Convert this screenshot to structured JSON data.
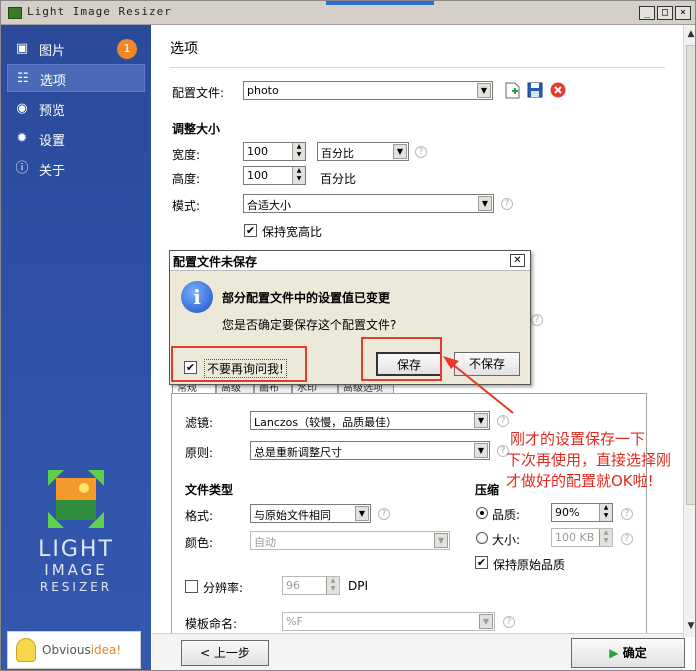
{
  "window": {
    "title": "Light Image Resizer",
    "buttons": [
      "_",
      "□",
      "×"
    ]
  },
  "sidebar": {
    "items": [
      {
        "label": "图片",
        "icon": "images-icon",
        "badge": "1"
      },
      {
        "label": "选项",
        "icon": "sliders-icon"
      },
      {
        "label": "预览",
        "icon": "eye-icon"
      },
      {
        "label": "设置",
        "icon": "gear-icon"
      },
      {
        "label": "关于",
        "icon": "info-icon"
      }
    ],
    "logo_lines": [
      "LIGHT",
      "IMAGE",
      "RESIZER"
    ],
    "brand": {
      "prefix": "Obvious",
      "suffix": "idea!"
    }
  },
  "options": {
    "title": "选项",
    "profile_label": "配置文件:",
    "profile_value": "photo",
    "resize_section": "调整大小",
    "width_label": "宽度:",
    "width_value": "100",
    "width_unit": "百分比",
    "height_label": "高度:",
    "height_value": "100",
    "height_unit": "百分比",
    "mode_label": "模式:",
    "mode_value": "合适大小",
    "keep_ratio_label": "保持宽高比",
    "keep_ratio_checked": "✔"
  },
  "panel": {
    "tabs": [
      "常规",
      "高级",
      "画布",
      "水印",
      "高级选项"
    ],
    "filter_label": "滤镜:",
    "filter_value": "Lanczos（较慢，品质最佳）",
    "rule_label": "原则:",
    "rule_value": "总是重新调整尺寸",
    "filetype_section": "文件类型",
    "format_label": "格式:",
    "format_value": "与原始文件相同",
    "color_label": "颜色:",
    "color_value": "自动",
    "compress_section": "压缩",
    "quality_label": "品质:",
    "quality_value": "90%",
    "size_label": "大小:",
    "size_value": "100 KB",
    "keep_quality_label": "保持原始品质",
    "keep_quality_checked": "✔",
    "resolution_label": "分辨率:",
    "resolution_value": "96",
    "resolution_unit": "DPI",
    "template_label": "模板命名:",
    "template_value": "%F"
  },
  "footer": {
    "prev_label": "< 上一步",
    "ok_label": "确定"
  },
  "dialog": {
    "title": "配置文件未保存",
    "heading": "部分配置文件中的设置值已变更",
    "message": "您是否确定要保存这个配置文件?",
    "dont_ask_label": "不要再询问我!",
    "dont_ask_checked": "✔",
    "save_label": "保存",
    "dont_save_label": "不保存"
  },
  "annotation": {
    "lines": [
      "刚才的设置保存一下",
      "下次再使用，直接选择刚",
      "才做好的配置就OK啦!"
    ],
    "color": "#e02b1f"
  }
}
